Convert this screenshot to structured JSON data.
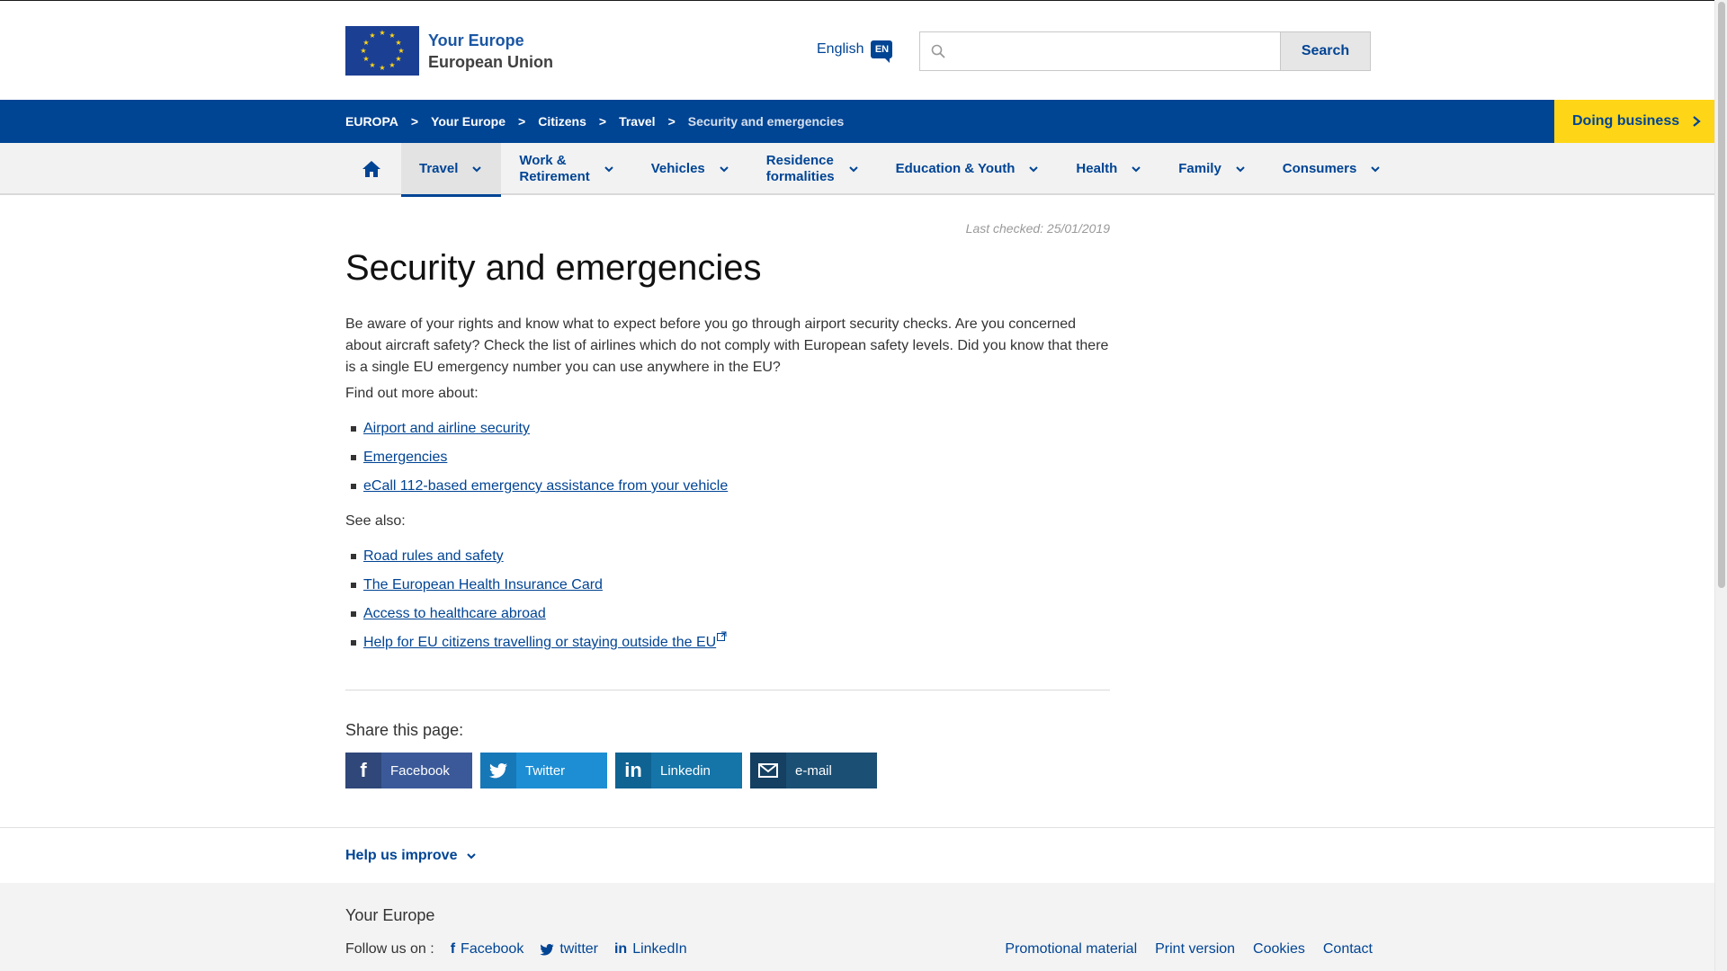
{
  "header": {
    "logo_line1": "Your Europe",
    "logo_line2": "European Union",
    "language": "English",
    "language_code": "EN",
    "search_placeholder": "",
    "search_button": "Search"
  },
  "breadcrumb": {
    "items": [
      "EUROPA",
      "Your Europe",
      "Citizens",
      "Travel"
    ],
    "separator": ">",
    "current": "Security and emergencies"
  },
  "doing_business": "Doing business",
  "nav": {
    "items": [
      {
        "line1": "Travel",
        "line2": "",
        "active": true
      },
      {
        "line1": "Work &",
        "line2": "Retirement"
      },
      {
        "line1": "Vehicles",
        "line2": ""
      },
      {
        "line1": "Residence",
        "line2": "formalities"
      },
      {
        "line1": "Education & Youth",
        "line2": ""
      },
      {
        "line1": "Health",
        "line2": ""
      },
      {
        "line1": "Family",
        "line2": ""
      },
      {
        "line1": "Consumers",
        "line2": ""
      }
    ]
  },
  "content": {
    "last_checked": "Last checked: 25/01/2019",
    "title": "Security and emergencies",
    "intro": "Be aware of your rights and know what to expect before you go through airport security checks. Are you concerned about aircraft safety? Check the list of airlines which do not comply with European safety levels. Did you know that there is a single EU emergency number you can use anywhere in the EU?",
    "find_out_label": "Find out more about:",
    "find_out_links": [
      "Airport and airline security",
      "Emergencies",
      "eCall 112-based emergency assistance from your vehicle"
    ],
    "see_also_label": "See also:",
    "see_also_links": [
      "Road rules and safety",
      "The European Health Insurance Card",
      "Access to healthcare abroad",
      "Help for EU citizens travelling or staying outside the EU"
    ]
  },
  "share": {
    "label": "Share this page:",
    "buttons": [
      "Facebook",
      "Twitter",
      "Linkedin",
      "e-mail"
    ]
  },
  "help": "Help us improve",
  "footer": {
    "site": "Your Europe",
    "follow_label": "Follow us on :",
    "social": [
      "Facebook",
      "twitter",
      "LinkedIn"
    ],
    "links": [
      "Promotional material",
      "Print version",
      "Cookies",
      "Contact"
    ]
  },
  "colors": {
    "brand_blue": "#004494",
    "accent_yellow": "#ffd617",
    "facebook": "#3b5998",
    "twitter": "#1d8ed4",
    "linkedin": "#1574a8",
    "email": "#1b4f74"
  }
}
